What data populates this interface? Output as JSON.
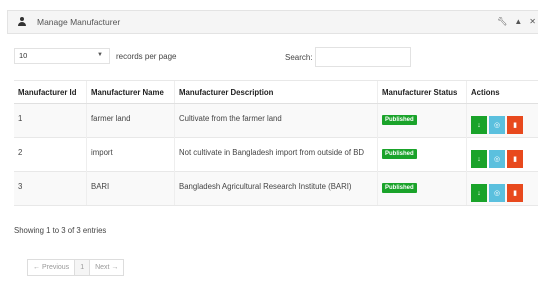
{
  "panel": {
    "title": "Manage Manufacturer",
    "tool_icons": {
      "wrench": "wrench-icon",
      "up": "chevron-up-icon",
      "close": "close-icon"
    }
  },
  "length": {
    "value": "10",
    "label": "records per page"
  },
  "search": {
    "label": "Search:",
    "value": ""
  },
  "table": {
    "headers": [
      "Manufacturer Id",
      "Manufacturer Name",
      "Manufacturer Description",
      "Manufacturer Status",
      "Actions"
    ],
    "rows": [
      {
        "id": "1",
        "name": "farmer land",
        "description": "Cultivate from the farmer land",
        "status": "Published"
      },
      {
        "id": "2",
        "name": "import",
        "description": "Not cultivate in Bangladesh import from outside of BD",
        "status": "Published"
      },
      {
        "id": "3",
        "name": "BARI",
        "description": "Bangladesh Agricultural Research Institute (BARI)",
        "status": "Published"
      }
    ]
  },
  "info": "Showing 1 to 3 of 3 entries",
  "pagination": {
    "prev": "← Previous",
    "current": "1",
    "next": "Next →"
  },
  "colors": {
    "published": "#1aa32a",
    "download": "#1aa32a",
    "edit": "#5bc0de",
    "delete": "#e8491d"
  }
}
